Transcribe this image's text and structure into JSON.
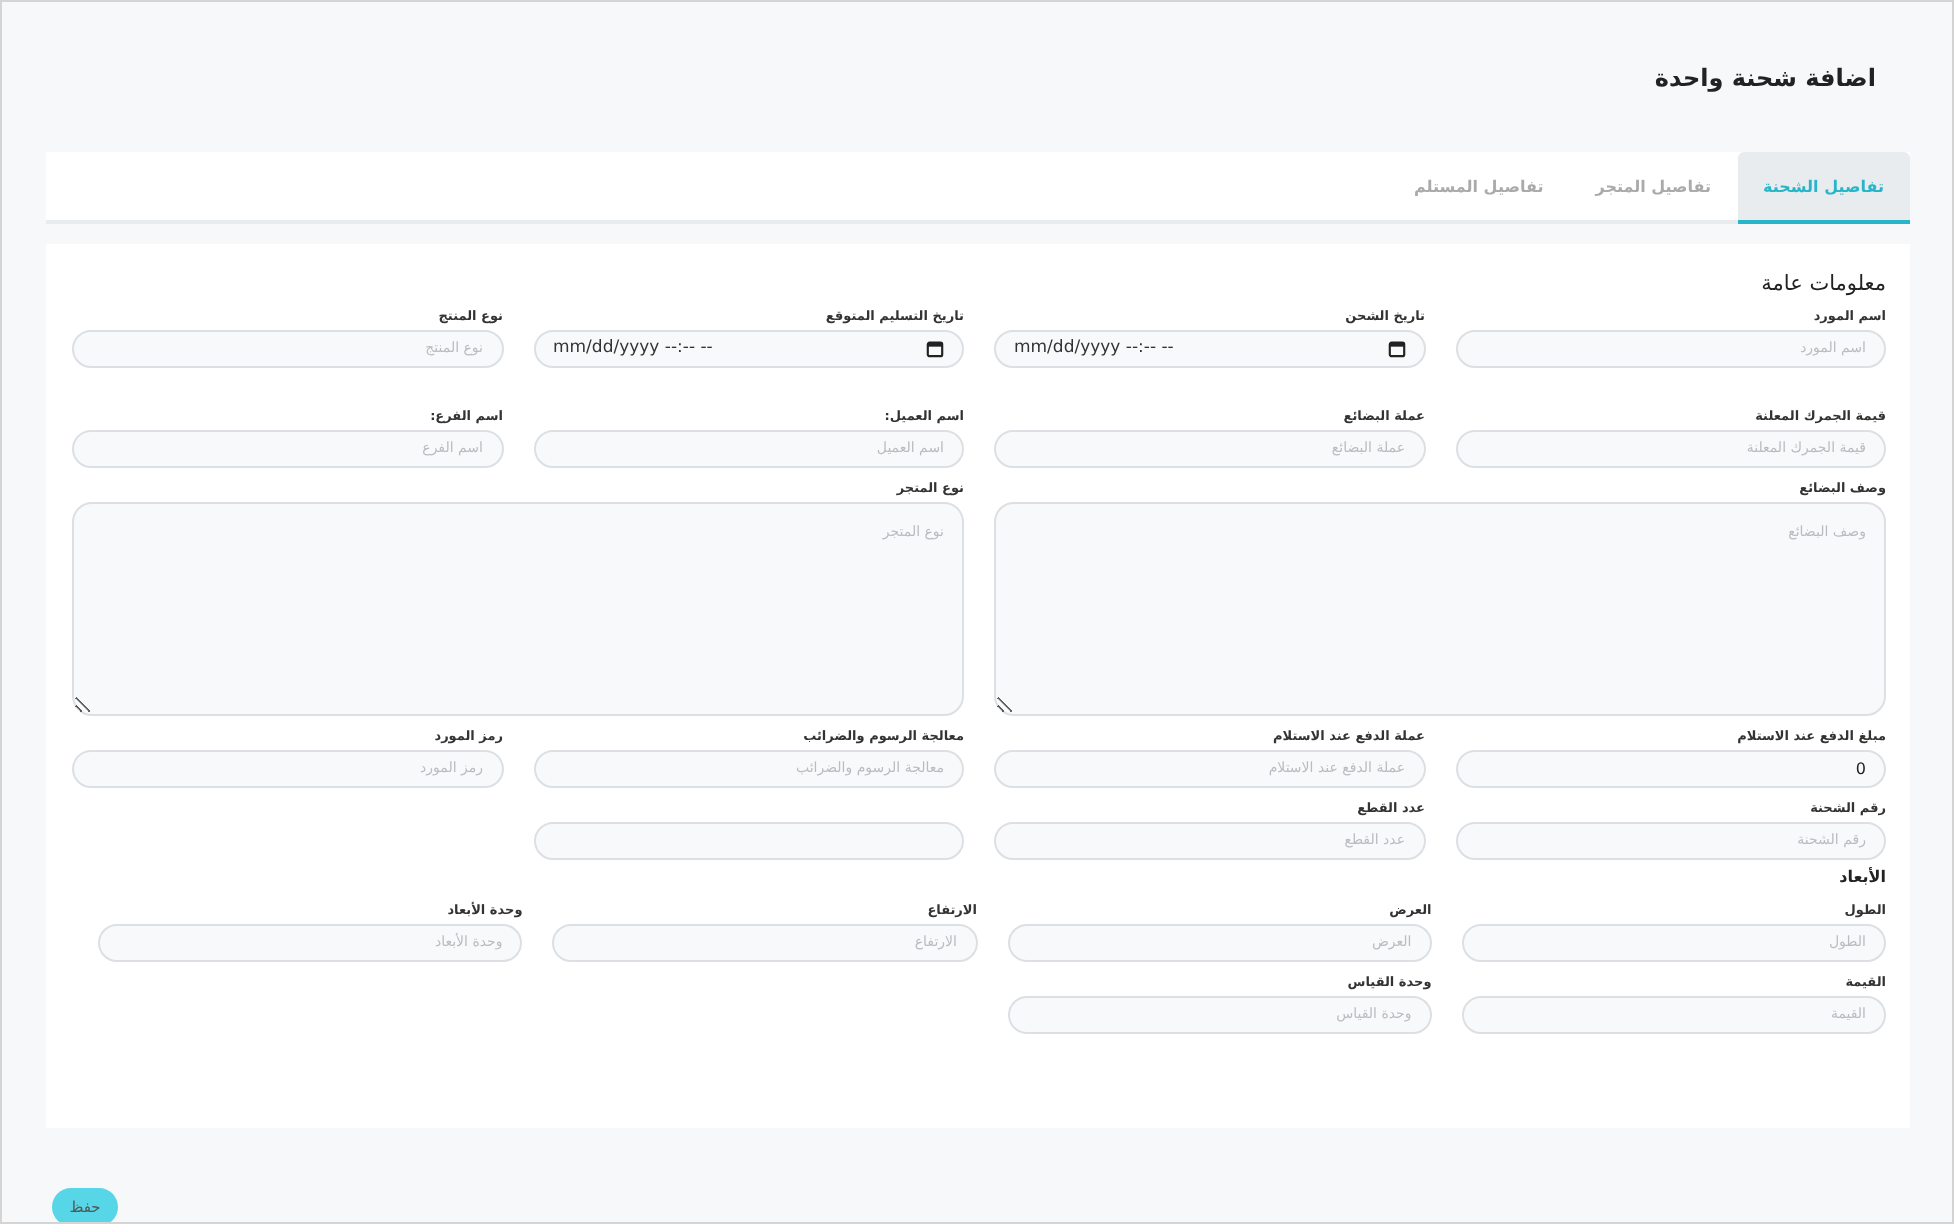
{
  "page": {
    "title": "اضافة شحنة واحدة"
  },
  "tabs": [
    {
      "label": "تفاصيل الشحنة",
      "selected": true
    },
    {
      "label": "تفاصيل المتجر",
      "selected": false
    },
    {
      "label": "تفاصيل المستلم",
      "selected": false
    }
  ],
  "general": {
    "heading": "معلومات عامة",
    "rows": [
      [
        {
          "kind": "text",
          "label": "اسم المورد",
          "placeholder": "اسم المورد"
        },
        {
          "kind": "datetime",
          "label": "تاريخ الشحن",
          "placeholder": "mm/dd/yyyy --:-- --"
        },
        {
          "kind": "datetime",
          "label": "تاريخ التسليم المتوقع",
          "placeholder": "mm/dd/yyyy --:-- --"
        },
        {
          "kind": "text",
          "label": "نوع المنتج",
          "placeholder": "نوع المنتج"
        }
      ],
      [
        {
          "kind": "text",
          "label": "قيمة الجمرك المعلنة",
          "placeholder": "قيمة الجمرك المعلنة"
        },
        {
          "kind": "text",
          "label": "عملة البضائع",
          "placeholder": "عملة البضائع"
        },
        {
          "kind": "text",
          "label": "اسم العميل:",
          "placeholder": "اسم العميل"
        },
        {
          "kind": "text",
          "label": "اسم الفرع:",
          "placeholder": "اسم الفرع"
        }
      ],
      [
        {
          "kind": "textarea",
          "label": "وصف البضائع",
          "placeholder": "وصف البضائع"
        },
        "",
        {
          "kind": "textarea",
          "label": "نوع المتجر",
          "placeholder": "نوع المتجر"
        }
      ],
      [
        {
          "kind": "text",
          "label": "مبلغ الدفع عند الاستلام",
          "value": "0"
        },
        {
          "kind": "text",
          "label": "عملة الدفع عند الاستلام",
          "placeholder": "عملة الدفع عند الاستلام"
        },
        {
          "kind": "text",
          "label": "معالجة الرسوم والضرائب",
          "placeholder": "معالجة الرسوم والضرائب"
        },
        {
          "kind": "text",
          "label": "رمز المورد",
          "placeholder": "رمز المورد"
        }
      ],
      [
        {
          "kind": "text",
          "label": "رقم الشحنة",
          "placeholder": "رقم الشحنة"
        },
        {
          "kind": "text",
          "label": "عدد القطع",
          "placeholder": "عدد القطع"
        },
        {
          "kind": "text"
        }
      ]
    ]
  },
  "dimensions": {
    "heading": "الأبعاد",
    "rows": [
      [
        {
          "kind": "text",
          "label": "الطول",
          "placeholder": "الطول"
        },
        {
          "kind": "text",
          "label": "العرض",
          "placeholder": "العرض"
        },
        {
          "kind": "text",
          "label": "الارتفاع",
          "placeholder": "الارتفاع"
        },
        {
          "kind": "text",
          "label": "وحدة الأبعاد",
          "placeholder": "وحدة الأبعاد"
        }
      ],
      [
        {
          "kind": "text",
          "label": "القيمة",
          "placeholder": "القيمة"
        },
        {
          "kind": "text",
          "label": "وحدة القياس",
          "placeholder": "وحدة القياس"
        }
      ]
    ]
  },
  "save_button": "حفظ"
}
